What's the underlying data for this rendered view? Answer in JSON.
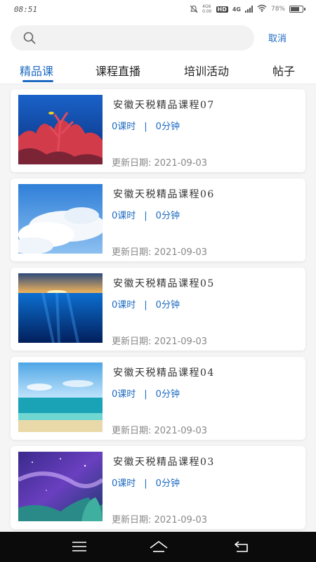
{
  "status_bar": {
    "time": "08:51",
    "signal_small": "4G6\n0.00",
    "hd": "HD",
    "network": "4G",
    "battery": "78%",
    "battery_level": 0.78
  },
  "search": {
    "placeholder": "",
    "value": "",
    "cancel_label": "取消"
  },
  "tabs": [
    {
      "label": "精品课",
      "active": true
    },
    {
      "label": "课程直播",
      "active": false
    },
    {
      "label": "培训活动",
      "active": false
    },
    {
      "label": "帖子",
      "active": false
    }
  ],
  "courses": [
    {
      "title": "安徽天税精品课程07",
      "lessons": "0课时",
      "separator": "|",
      "duration": "0分钟",
      "updated": "更新日期: 2021-09-03",
      "thumbnail": "coral-reef"
    },
    {
      "title": "安徽天税精品课程06",
      "lessons": "0课时",
      "separator": "|",
      "duration": "0分钟",
      "updated": "更新日期: 2021-09-03",
      "thumbnail": "clouds-sky"
    },
    {
      "title": "安徽天税精品课程05",
      "lessons": "0课时",
      "separator": "|",
      "duration": "0分钟",
      "updated": "更新日期: 2021-09-03",
      "thumbnail": "underwater-sunset"
    },
    {
      "title": "安徽天税精品课程04",
      "lessons": "0课时",
      "separator": "|",
      "duration": "0分钟",
      "updated": "更新日期: 2021-09-03",
      "thumbnail": "beach"
    },
    {
      "title": "安徽天税精品课程03",
      "lessons": "0课时",
      "separator": "|",
      "duration": "0分钟",
      "updated": "更新日期: 2021-09-03",
      "thumbnail": "night-sky"
    }
  ],
  "nav_bar": {
    "icons": [
      "menu-icon",
      "home-icon",
      "back-icon"
    ]
  },
  "colors": {
    "accent": "#1d6ac0",
    "title_text": "#333333",
    "date_text": "#888888"
  }
}
